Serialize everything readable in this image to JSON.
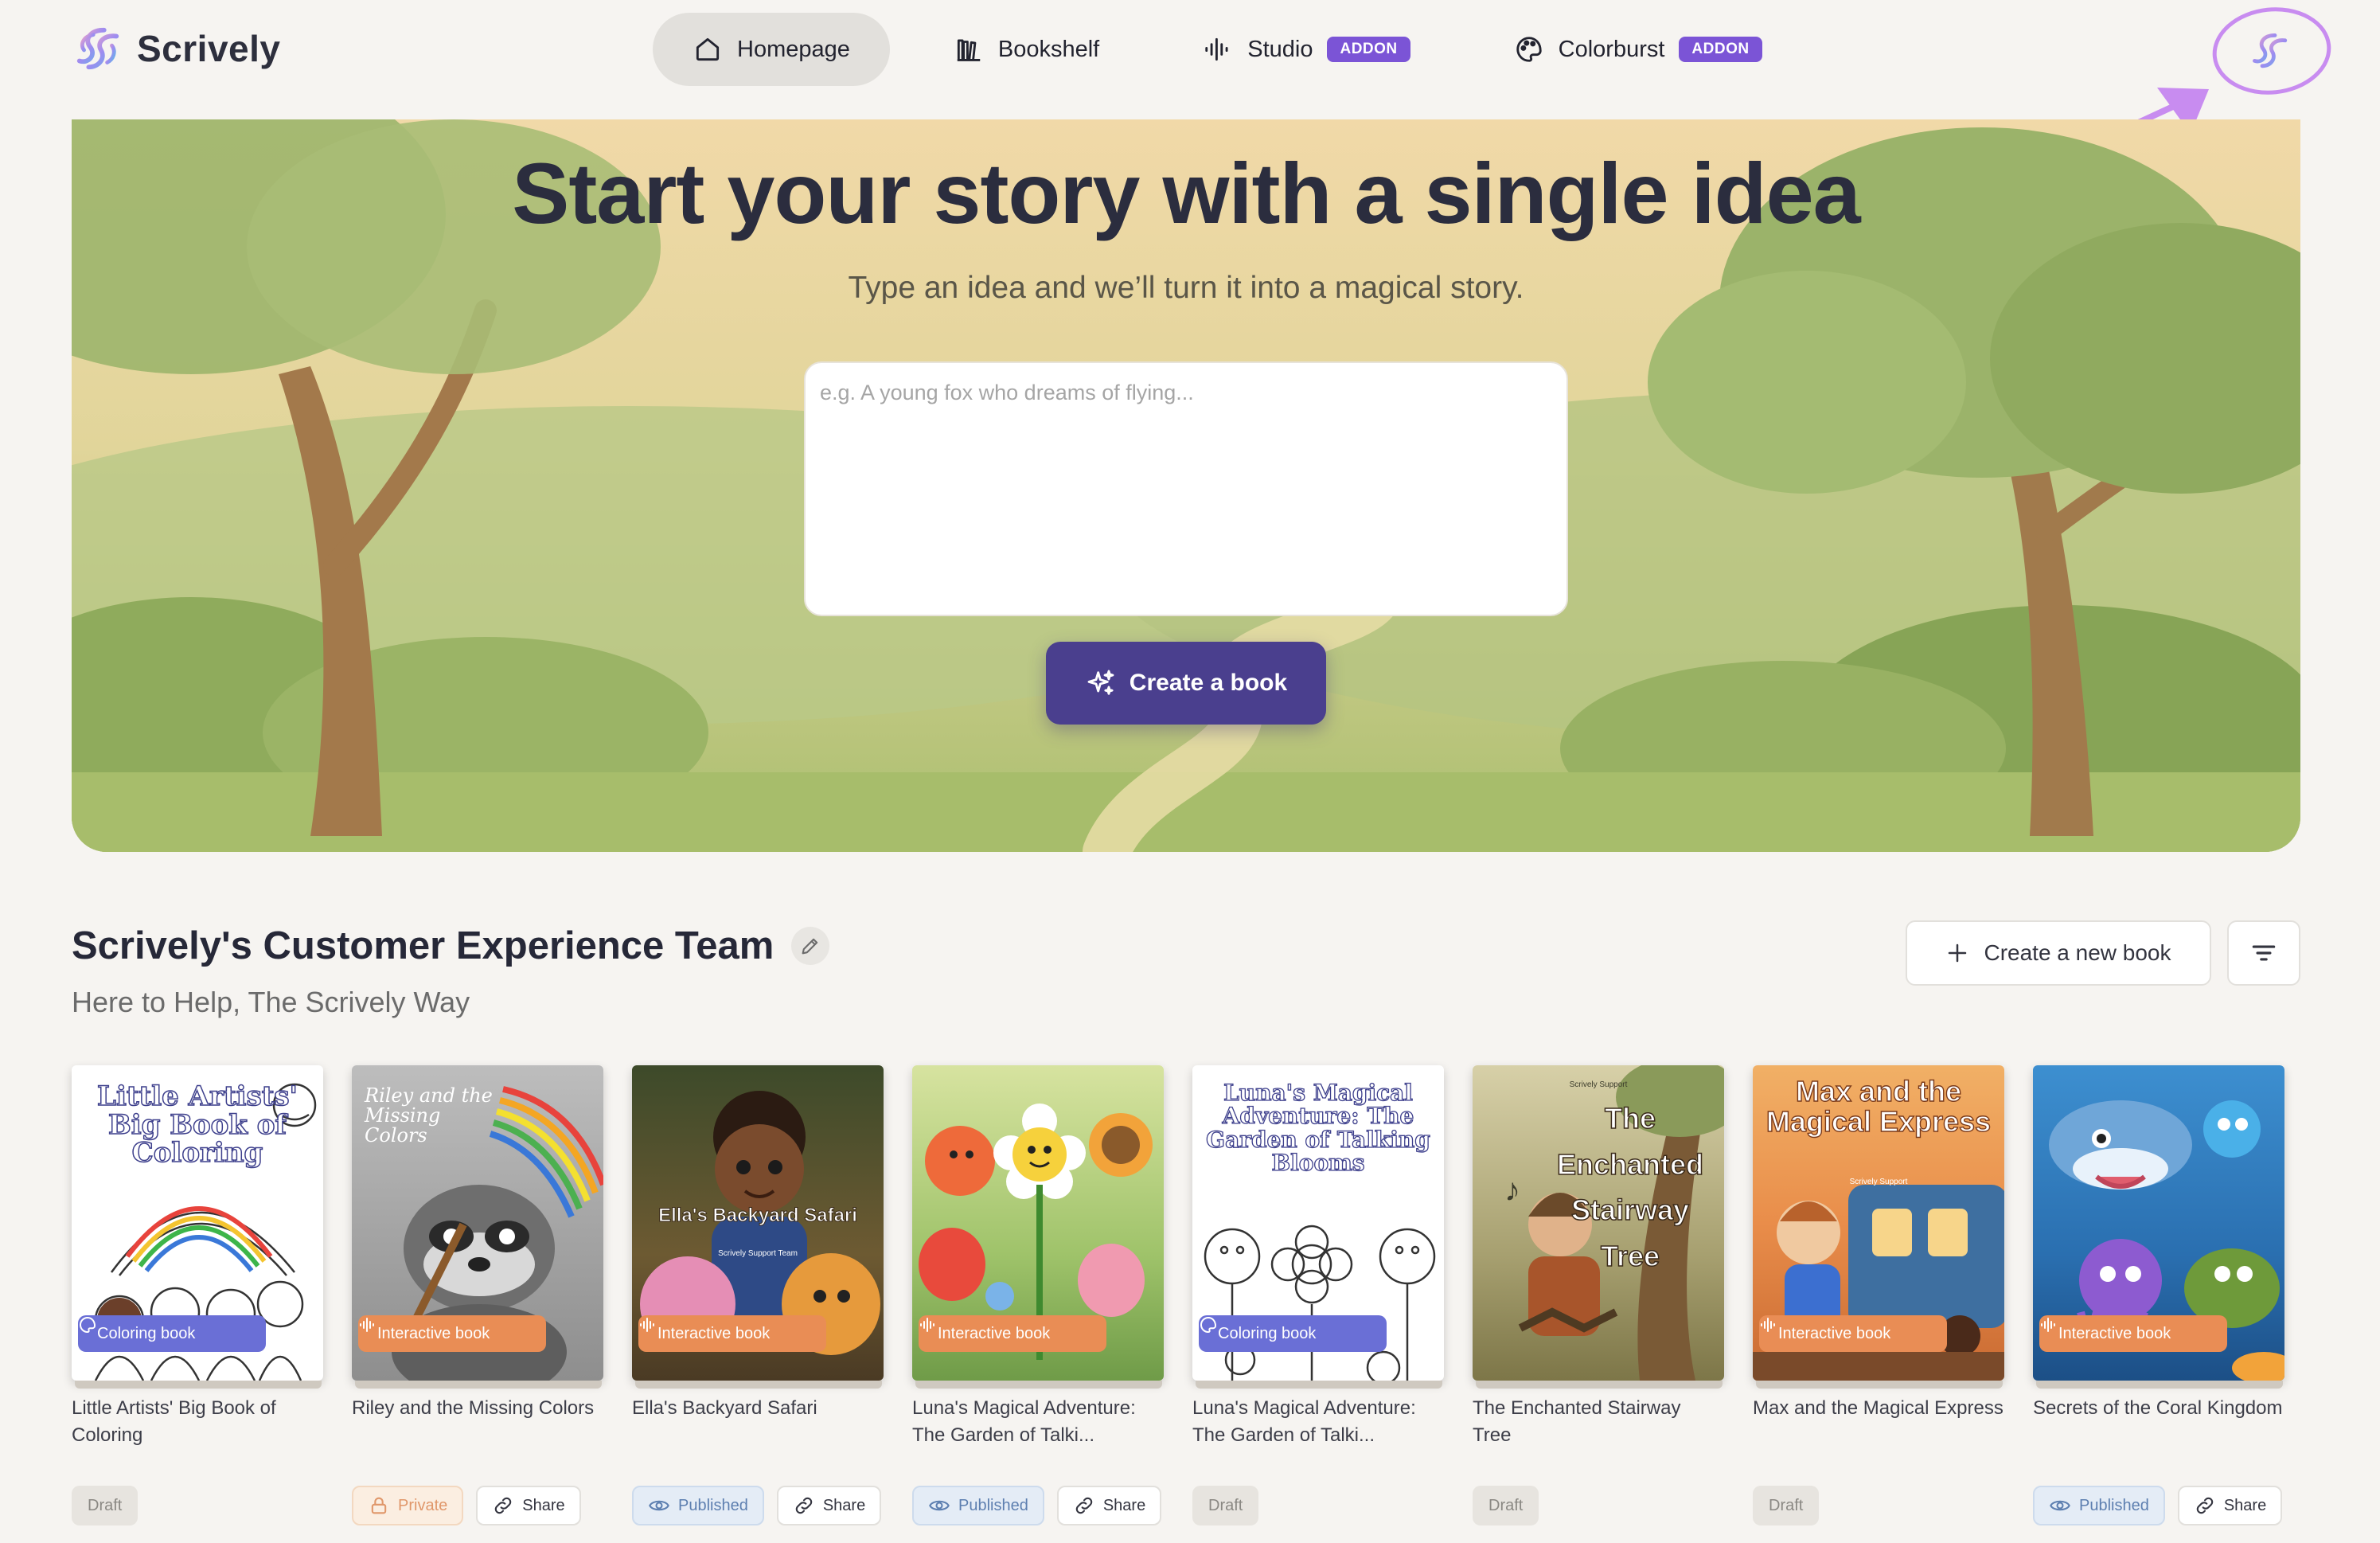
{
  "brand": {
    "name": "Scrively"
  },
  "nav": {
    "items": [
      {
        "label": "Homepage",
        "icon": "home-icon",
        "active": true,
        "badge": ""
      },
      {
        "label": "Bookshelf",
        "icon": "books-icon",
        "active": false,
        "badge": ""
      },
      {
        "label": "Studio",
        "icon": "audio-wave-icon",
        "active": false,
        "badge": "ADDON"
      },
      {
        "label": "Colorburst",
        "icon": "palette-icon",
        "active": false,
        "badge": "ADDON"
      }
    ]
  },
  "hero": {
    "title": "Start your story with a single idea",
    "subtitle": "Type an idea and we’ll turn it into a magical story.",
    "input_placeholder": "e.g. A young fox who dreams of flying...",
    "input_value": "",
    "cta_label": "Create a book"
  },
  "team": {
    "title": "Scrively's Customer Experience Team",
    "subtitle": "Here to Help, The Scrively Way",
    "new_book_label": "Create a new book"
  },
  "books": [
    {
      "name": "Little Artists' Big Book of Coloring",
      "cover_title": "Little Artists' Big Book of Coloring",
      "type": "Coloring book",
      "status": "Draft",
      "share": ""
    },
    {
      "name": "Riley and the Missing Colors",
      "cover_title": "Riley and the Missing Colors",
      "type": "Interactive book",
      "status": "Private",
      "share": "Share"
    },
    {
      "name": "Ella's Backyard Safari",
      "cover_title": "Ella's Backyard Safari",
      "cover_subtitle": "Scrively Support Team",
      "type": "Interactive book",
      "status": "Published",
      "share": "Share"
    },
    {
      "name": "Luna's Magical Adventure: The Garden of Talki...",
      "cover_title": "",
      "type": "Interactive book",
      "status": "Published",
      "share": "Share"
    },
    {
      "name": "Luna's Magical Adventure: The Garden of Talki...",
      "cover_title": "Luna's Magical Adventure: The Garden of Talking Blooms",
      "type": "Coloring book",
      "status": "Draft",
      "share": ""
    },
    {
      "name": "The Enchanted Stairway Tree",
      "cover_title": "The Enchanted Stairway Tree",
      "cover_subtitle": "Scrively Support",
      "type": "",
      "status": "Draft",
      "share": ""
    },
    {
      "name": "Max and the Magical Express",
      "cover_title": "Max and the Magical Express",
      "cover_subtitle": "Scrively Support",
      "type": "Interactive book",
      "status": "Draft",
      "share": ""
    },
    {
      "name": "Secrets of the Coral Kingdom",
      "cover_title": "",
      "type": "Interactive book",
      "status": "Published",
      "share": "Share"
    }
  ],
  "colors": {
    "accent": "#4a3f8e",
    "addon": "#7b54d6",
    "coloring_badge": "#6a6fd6",
    "interactive_badge": "#e98d55",
    "annotation": "#c88cf0"
  }
}
